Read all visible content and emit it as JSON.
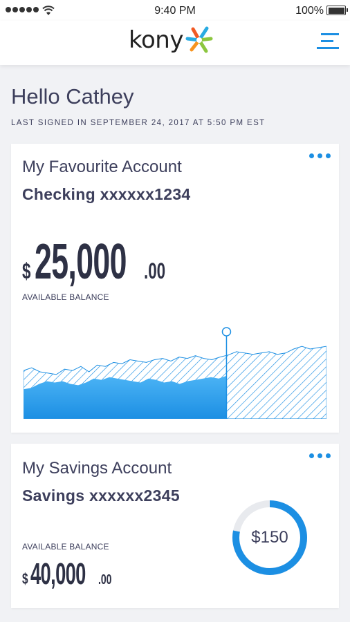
{
  "status_bar": {
    "time": "9:40 PM",
    "battery": "100%"
  },
  "header": {
    "logo_text": "kony",
    "menu_icon": "hamburger-menu-icon"
  },
  "greeting": {
    "title": "Hello Cathey",
    "last_signed": "LAST SIGNED IN SEPTEMBER 24, 2017 AT 5:50 PM EST"
  },
  "accounts": [
    {
      "label": "My Favourite Account",
      "name": "Checking xxxxxx1234",
      "currency": "$",
      "balance_main": "25,000",
      "balance_cents": ".00",
      "balance_caption": "AVAILABLE BALANCE",
      "chart_values": [
        72,
        76,
        70,
        68,
        66,
        74,
        72,
        78,
        70,
        80,
        78,
        84,
        82,
        88,
        86,
        84,
        88,
        90,
        86,
        92,
        90,
        94,
        90,
        88,
        92,
        95,
        100,
        98,
        96,
        98,
        100,
        96,
        98,
        104,
        108,
        104,
        106,
        108
      ],
      "chart_actual_values": [
        44,
        46,
        52,
        56,
        54,
        56,
        52,
        50,
        54,
        60,
        58,
        62,
        60,
        58,
        56,
        54,
        60,
        58,
        54,
        56,
        52,
        56,
        58,
        60,
        62,
        60,
        64
      ],
      "chart_marker_index": 26
    },
    {
      "label": "My Savings Account",
      "name": "Savings xxxxxx2345",
      "currency": "$",
      "balance_main": "40,000",
      "balance_cents": ".00",
      "balance_caption": "AVAILABLE BALANCE",
      "donut_label": "$150",
      "donut_fraction": 0.78
    }
  ],
  "colors": {
    "accent": "#1c8fe3",
    "text": "#3d3f5c",
    "donut_track": "#e8eaee"
  }
}
